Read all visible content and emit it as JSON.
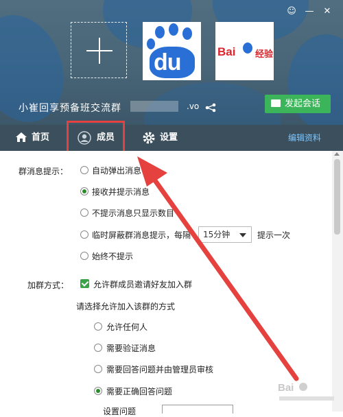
{
  "header": {
    "group_name": "小崔回享预备班交流群",
    "group_id_suffix": ".vo",
    "start_chat_label": "发起会话",
    "photo1_text": "du",
    "photo2_text_bai": "Bai",
    "photo2_text_jy": "经验"
  },
  "tabs": {
    "home": "首页",
    "members": "成员",
    "settings": "设置",
    "edit": "编辑资料"
  },
  "settings": {
    "msg_label": "群消息提示：",
    "msg_options": [
      "自动弹出消息",
      "接收并提示消息",
      "不提示消息只显示数目",
      "临时屏蔽群消息提示，每隔",
      "始终不提示"
    ],
    "interval_value": "15分钟",
    "interval_suffix": "提示一次",
    "join_label": "加群方式：",
    "allow_invite": "允许群成员邀请好友加入群",
    "join_prompt": "请选择允许加入该群的方式",
    "join_options": [
      "允许任何人",
      "需要验证消息",
      "需要回答问题并由管理员审核",
      "需要正确回答问题"
    ],
    "cut_text": "设置问题"
  },
  "colors": {
    "accent_green": "#3cb55a",
    "tabbar": "#3b4f5c",
    "annotation_red": "#e5413f"
  }
}
